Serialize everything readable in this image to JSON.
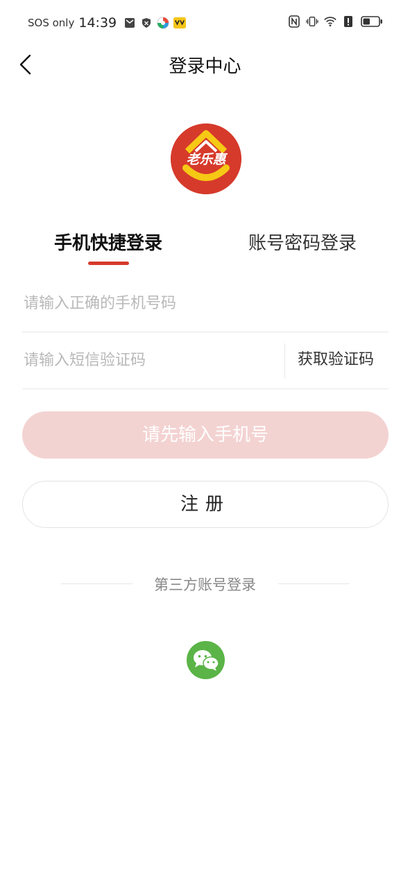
{
  "status_bar": {
    "carrier": "SOS only",
    "time": "14:39",
    "battery_level": 0.45
  },
  "nav": {
    "title": "登录中心"
  },
  "logo": {
    "text": "老乐惠"
  },
  "tabs": [
    {
      "label": "手机快捷登录",
      "active": true
    },
    {
      "label": "账号密码登录",
      "active": false
    }
  ],
  "form": {
    "phone_placeholder": "请输入正确的手机号码",
    "phone_value": "",
    "code_placeholder": "请输入短信验证码",
    "code_value": "",
    "get_code_label": "获取验证码"
  },
  "buttons": {
    "login_label": "请先输入手机号",
    "register_label": "注册"
  },
  "third_party": {
    "title": "第三方账号登录",
    "providers": [
      "wechat"
    ]
  },
  "colors": {
    "accent": "#d63a2b",
    "login_disabled_bg": "#f3d3d2",
    "wechat": "#5bb447"
  }
}
